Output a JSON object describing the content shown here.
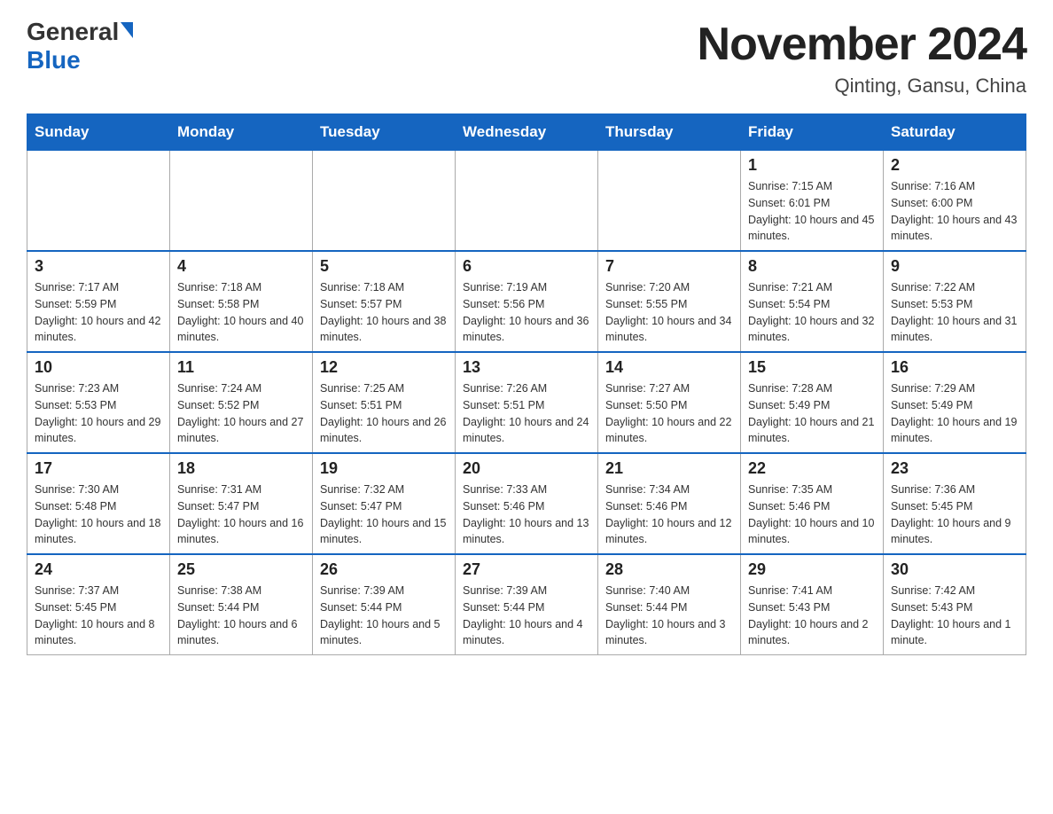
{
  "header": {
    "logo_general": "General",
    "logo_blue": "Blue",
    "title": "November 2024",
    "subtitle": "Qinting, Gansu, China"
  },
  "days_of_week": [
    "Sunday",
    "Monday",
    "Tuesday",
    "Wednesday",
    "Thursday",
    "Friday",
    "Saturday"
  ],
  "weeks": [
    [
      {
        "day": "",
        "info": ""
      },
      {
        "day": "",
        "info": ""
      },
      {
        "day": "",
        "info": ""
      },
      {
        "day": "",
        "info": ""
      },
      {
        "day": "",
        "info": ""
      },
      {
        "day": "1",
        "info": "Sunrise: 7:15 AM\nSunset: 6:01 PM\nDaylight: 10 hours and 45 minutes."
      },
      {
        "day": "2",
        "info": "Sunrise: 7:16 AM\nSunset: 6:00 PM\nDaylight: 10 hours and 43 minutes."
      }
    ],
    [
      {
        "day": "3",
        "info": "Sunrise: 7:17 AM\nSunset: 5:59 PM\nDaylight: 10 hours and 42 minutes."
      },
      {
        "day": "4",
        "info": "Sunrise: 7:18 AM\nSunset: 5:58 PM\nDaylight: 10 hours and 40 minutes."
      },
      {
        "day": "5",
        "info": "Sunrise: 7:18 AM\nSunset: 5:57 PM\nDaylight: 10 hours and 38 minutes."
      },
      {
        "day": "6",
        "info": "Sunrise: 7:19 AM\nSunset: 5:56 PM\nDaylight: 10 hours and 36 minutes."
      },
      {
        "day": "7",
        "info": "Sunrise: 7:20 AM\nSunset: 5:55 PM\nDaylight: 10 hours and 34 minutes."
      },
      {
        "day": "8",
        "info": "Sunrise: 7:21 AM\nSunset: 5:54 PM\nDaylight: 10 hours and 32 minutes."
      },
      {
        "day": "9",
        "info": "Sunrise: 7:22 AM\nSunset: 5:53 PM\nDaylight: 10 hours and 31 minutes."
      }
    ],
    [
      {
        "day": "10",
        "info": "Sunrise: 7:23 AM\nSunset: 5:53 PM\nDaylight: 10 hours and 29 minutes."
      },
      {
        "day": "11",
        "info": "Sunrise: 7:24 AM\nSunset: 5:52 PM\nDaylight: 10 hours and 27 minutes."
      },
      {
        "day": "12",
        "info": "Sunrise: 7:25 AM\nSunset: 5:51 PM\nDaylight: 10 hours and 26 minutes."
      },
      {
        "day": "13",
        "info": "Sunrise: 7:26 AM\nSunset: 5:51 PM\nDaylight: 10 hours and 24 minutes."
      },
      {
        "day": "14",
        "info": "Sunrise: 7:27 AM\nSunset: 5:50 PM\nDaylight: 10 hours and 22 minutes."
      },
      {
        "day": "15",
        "info": "Sunrise: 7:28 AM\nSunset: 5:49 PM\nDaylight: 10 hours and 21 minutes."
      },
      {
        "day": "16",
        "info": "Sunrise: 7:29 AM\nSunset: 5:49 PM\nDaylight: 10 hours and 19 minutes."
      }
    ],
    [
      {
        "day": "17",
        "info": "Sunrise: 7:30 AM\nSunset: 5:48 PM\nDaylight: 10 hours and 18 minutes."
      },
      {
        "day": "18",
        "info": "Sunrise: 7:31 AM\nSunset: 5:47 PM\nDaylight: 10 hours and 16 minutes."
      },
      {
        "day": "19",
        "info": "Sunrise: 7:32 AM\nSunset: 5:47 PM\nDaylight: 10 hours and 15 minutes."
      },
      {
        "day": "20",
        "info": "Sunrise: 7:33 AM\nSunset: 5:46 PM\nDaylight: 10 hours and 13 minutes."
      },
      {
        "day": "21",
        "info": "Sunrise: 7:34 AM\nSunset: 5:46 PM\nDaylight: 10 hours and 12 minutes."
      },
      {
        "day": "22",
        "info": "Sunrise: 7:35 AM\nSunset: 5:46 PM\nDaylight: 10 hours and 10 minutes."
      },
      {
        "day": "23",
        "info": "Sunrise: 7:36 AM\nSunset: 5:45 PM\nDaylight: 10 hours and 9 minutes."
      }
    ],
    [
      {
        "day": "24",
        "info": "Sunrise: 7:37 AM\nSunset: 5:45 PM\nDaylight: 10 hours and 8 minutes."
      },
      {
        "day": "25",
        "info": "Sunrise: 7:38 AM\nSunset: 5:44 PM\nDaylight: 10 hours and 6 minutes."
      },
      {
        "day": "26",
        "info": "Sunrise: 7:39 AM\nSunset: 5:44 PM\nDaylight: 10 hours and 5 minutes."
      },
      {
        "day": "27",
        "info": "Sunrise: 7:39 AM\nSunset: 5:44 PM\nDaylight: 10 hours and 4 minutes."
      },
      {
        "day": "28",
        "info": "Sunrise: 7:40 AM\nSunset: 5:44 PM\nDaylight: 10 hours and 3 minutes."
      },
      {
        "day": "29",
        "info": "Sunrise: 7:41 AM\nSunset: 5:43 PM\nDaylight: 10 hours and 2 minutes."
      },
      {
        "day": "30",
        "info": "Sunrise: 7:42 AM\nSunset: 5:43 PM\nDaylight: 10 hours and 1 minute."
      }
    ]
  ]
}
